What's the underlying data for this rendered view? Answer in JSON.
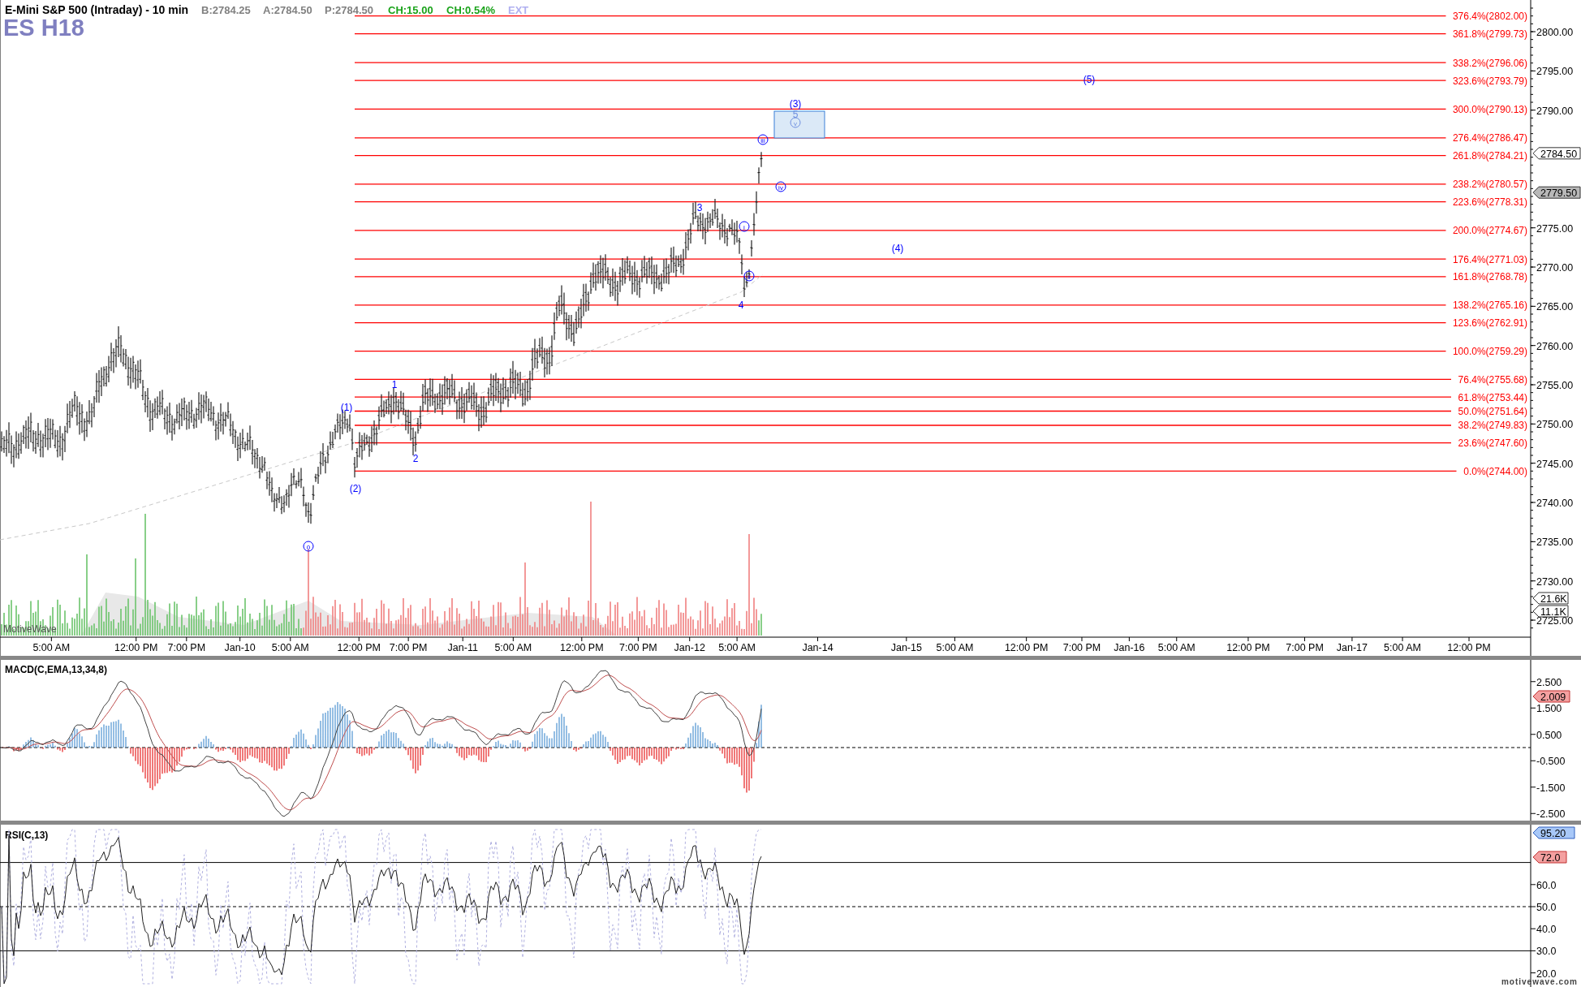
{
  "header": {
    "title": "E-Mini S&P 500 (Intraday) - 10 min",
    "symbol": "ES H18",
    "quotes": [
      {
        "text": "B:2784.25",
        "kind": "neutral"
      },
      {
        "text": "A:2784.50",
        "kind": "neutral"
      },
      {
        "text": "P:2784.50",
        "kind": "neutral"
      },
      {
        "text": "CH:15.00",
        "kind": "up"
      },
      {
        "text": "CH:0.54%",
        "kind": "up"
      },
      {
        "text": "EXT",
        "kind": "ext"
      }
    ]
  },
  "price_panel": {
    "fib_levels": [
      {
        "ratio": "376.4%",
        "value": "(2802.00)"
      },
      {
        "ratio": "361.8%",
        "value": "(2799.73)"
      },
      {
        "ratio": "338.2%",
        "value": "(2796.06)"
      },
      {
        "ratio": "323.6%",
        "value": "(2793.79)"
      },
      {
        "ratio": "300.0%",
        "value": "(2790.13)"
      },
      {
        "ratio": "276.4%",
        "value": "(2786.47)"
      },
      {
        "ratio": "261.8%",
        "value": "(2784.21)"
      },
      {
        "ratio": "238.2%",
        "value": "(2780.57)"
      },
      {
        "ratio": "223.6%",
        "value": "(2778.31)"
      },
      {
        "ratio": "200.0%",
        "value": "(2774.67)"
      },
      {
        "ratio": "176.4%",
        "value": "(2771.03)"
      },
      {
        "ratio": "161.8%",
        "value": "(2768.78)"
      },
      {
        "ratio": "138.2%",
        "value": "(2765.16)"
      },
      {
        "ratio": "123.6%",
        "value": "(2762.91)"
      },
      {
        "ratio": "100.0%",
        "value": "(2759.29)"
      },
      {
        "ratio": "76.4%",
        "value": "(2755.68)"
      },
      {
        "ratio": "61.8%",
        "value": "(2753.44)"
      },
      {
        "ratio": "50.0%",
        "value": "(2751.64)"
      },
      {
        "ratio": "38.2%",
        "value": "(2749.83)"
      },
      {
        "ratio": "23.6%",
        "value": "(2747.60)"
      },
      {
        "ratio": "0.0%",
        "value": "(2744.00)"
      }
    ],
    "wave_labels": [
      {
        "text": "(1)",
        "kind": "plain"
      },
      {
        "text": "(2)",
        "kind": "plain"
      },
      {
        "text": "0",
        "kind": "circled"
      },
      {
        "text": "1",
        "kind": "plain"
      },
      {
        "text": "2",
        "kind": "plain"
      },
      {
        "text": "3",
        "kind": "plain"
      },
      {
        "text": "4",
        "kind": "plain"
      },
      {
        "text": "(3)",
        "kind": "plain"
      },
      {
        "text": "5",
        "kind": "faint"
      },
      {
        "text": "v",
        "kind": "faint-circled"
      },
      {
        "text": "i",
        "kind": "circled"
      },
      {
        "text": "ii",
        "kind": "circled"
      },
      {
        "text": "iii",
        "kind": "circled"
      },
      {
        "text": "iv",
        "kind": "circled"
      },
      {
        "text": "(4)",
        "kind": "plain"
      },
      {
        "text": "(5)",
        "kind": "plain"
      }
    ],
    "y_ticks": [
      "2800.00",
      "2795.00",
      "2790.00",
      "2775.00",
      "2770.00",
      "2765.00",
      "2760.00",
      "2755.00",
      "2750.00",
      "2745.00",
      "2740.00",
      "2735.00",
      "2730.00",
      "2725.00"
    ],
    "price_badges": [
      {
        "text": "2784.50",
        "kind": "last"
      },
      {
        "text": "2779.50",
        "kind": "marker"
      }
    ],
    "volume_badges": [
      "21.6K",
      "11.1K"
    ],
    "branding": "MotiveWave"
  },
  "x_axis": {
    "labels": [
      "5:00 AM",
      "12:00 PM",
      "7:00 PM",
      "Jan-10",
      "5:00 AM",
      "12:00 PM",
      "7:00 PM",
      "Jan-11",
      "5:00 AM",
      "12:00 PM",
      "7:00 PM",
      "Jan-12",
      "5:00 AM",
      "Jan-14",
      "Jan-15",
      "5:00 AM",
      "12:00 PM",
      "7:00 PM",
      "Jan-16",
      "5:00 AM",
      "12:00 PM",
      "7:00 PM",
      "Jan-17",
      "5:00 AM",
      "12:00 PM"
    ]
  },
  "macd_panel": {
    "title": "MACD(C,EMA,13,34,8)",
    "ticks": [
      "2.500",
      "1.500",
      "0.500",
      "-0.500",
      "-1.500",
      "-2.500"
    ],
    "badge": "2.009"
  },
  "rsi_panel": {
    "title": "RSI(C,13)",
    "ticks": [
      "60.0",
      "50.0",
      "40.0",
      "30.0",
      "20.0"
    ],
    "badges": [
      {
        "text": "95.20",
        "kind": "blue"
      },
      {
        "text": "72.0",
        "kind": "red"
      }
    ]
  },
  "footer": {
    "website": "motivewave.com"
  }
}
